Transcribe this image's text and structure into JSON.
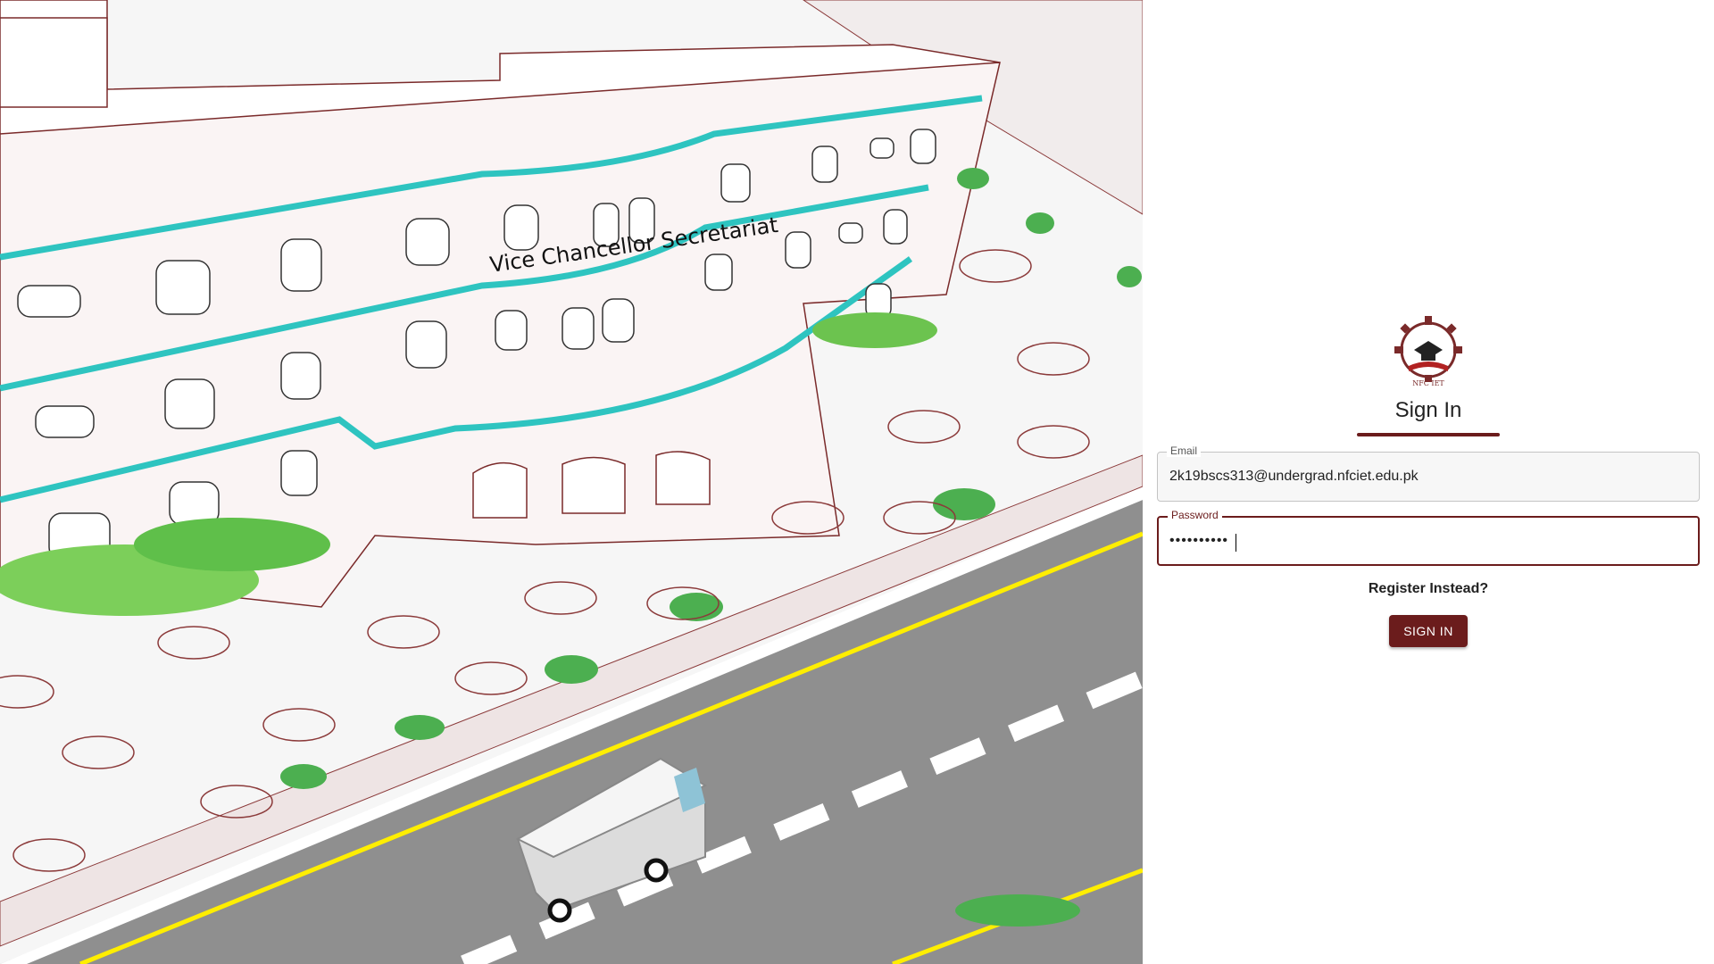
{
  "hero": {
    "building_sign": "Vice Chancellor Secretariat"
  },
  "logo": {
    "icon": "nfc-iet-logo",
    "caption": "NFC IET"
  },
  "signin": {
    "title": "Sign In",
    "email_label": "Email",
    "email_value": "2k19bscs313@undergrad.nfciet.edu.pk",
    "password_label": "Password",
    "password_value": "••••••••••",
    "register_link": "Register Instead?",
    "submit_label": "SIGN IN"
  },
  "colors": {
    "accent": "#6b1c1c",
    "building_stripe": "#2ec4c0",
    "road": "#8f8f8f",
    "road_edge": "#ffee00"
  }
}
